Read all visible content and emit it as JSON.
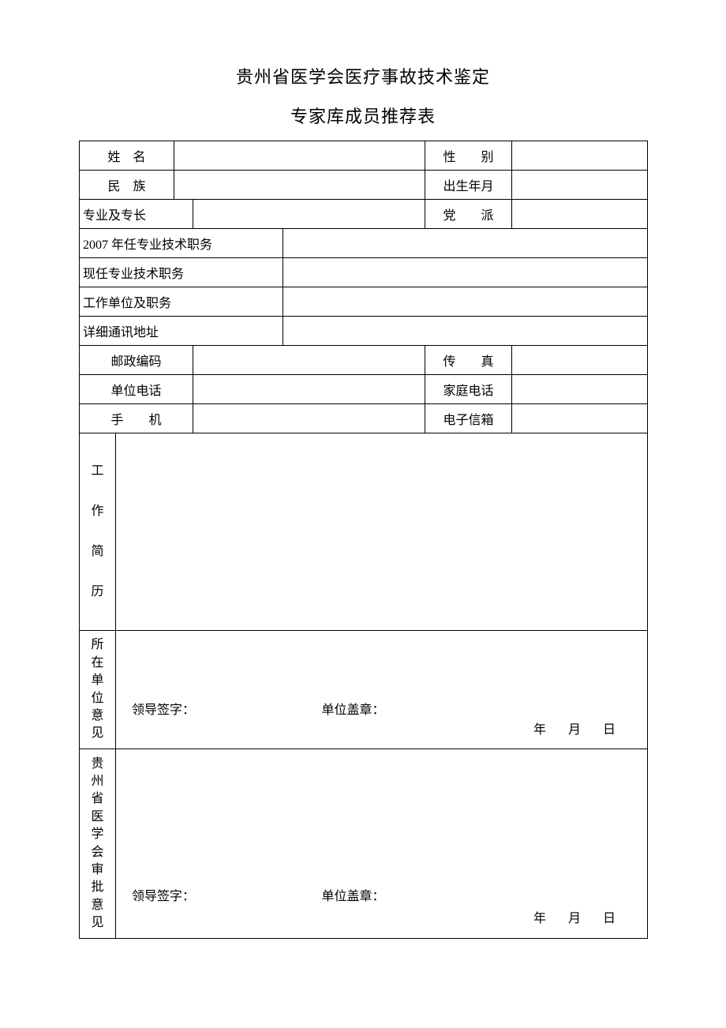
{
  "title": "贵州省医学会医疗事故技术鉴定",
  "subtitle": "专家库成员推荐表",
  "labels": {
    "name": "姓　名",
    "gender": "性　　别",
    "ethnicity": "民　族",
    "birth": "出生年月",
    "specialty": "专业及专长",
    "party": "党　　派",
    "pos2007": "2007 年任专业技术职务",
    "posNow": "现任专业技术职务",
    "workUnit": "工作单位及职务",
    "address": "详细通讯地址",
    "postcode": "邮政编码",
    "fax": "传　　真",
    "unitPhone": "单位电话",
    "homePhone": "家庭电话",
    "mobile": "手　　机",
    "email": "电子信箱",
    "resume1": "工",
    "resume2": "作",
    "resume3": "简",
    "resume4": "历",
    "unitOpinion1": "所",
    "unitOpinion2": "在",
    "unitOpinion3": "单",
    "unitOpinion4": "位",
    "unitOpinion5": "意",
    "unitOpinion6": "见",
    "assocOpinion1": "贵",
    "assocOpinion2": "州",
    "assocOpinion3": "省",
    "assocOpinion4": "医",
    "assocOpinion5": "学",
    "assocOpinion6": "会",
    "assocOpinion7": "审",
    "assocOpinion8": "批",
    "assocOpinion9": "意",
    "assocOpinion10": "见",
    "leaderSign": "领导签字：",
    "unitSeal": "单位盖章：",
    "year": "年",
    "month": "月",
    "day": "日"
  },
  "values": {
    "name": "",
    "gender": "",
    "ethnicity": "",
    "birth": "",
    "specialty": "",
    "party": "",
    "pos2007": "",
    "posNow": "",
    "workUnit": "",
    "address": "",
    "postcode": "",
    "fax": "",
    "unitPhone": "",
    "homePhone": "",
    "mobile": "",
    "email": ""
  }
}
